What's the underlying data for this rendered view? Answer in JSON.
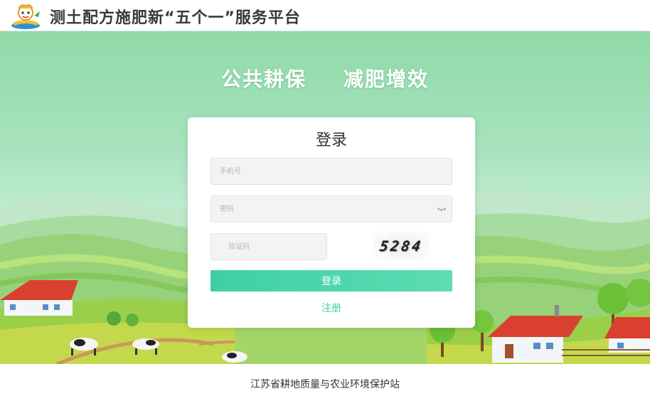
{
  "header": {
    "title": "测土配方施肥新“五个一”服务平台"
  },
  "hero": {
    "slogan_left": "公共耕保",
    "slogan_right": "减肥增效"
  },
  "login": {
    "title": "登录",
    "phone_placeholder": "手机号",
    "password_placeholder": "密码",
    "captcha_placeholder": "验证码",
    "captcha_code": "5284",
    "submit_label": "登录",
    "register_label": "注册"
  },
  "footer": {
    "text": "江苏省耕地质量与农业环境保护站"
  },
  "colors": {
    "accent": "#3fcfa4",
    "hero_sky": "#a7e3bd",
    "hill_green": "#7cc24c",
    "roof_red": "#d9402f"
  },
  "icons": {
    "logo": "cartoon-mascot-logo",
    "password_toggle": "eye-closed-icon"
  }
}
